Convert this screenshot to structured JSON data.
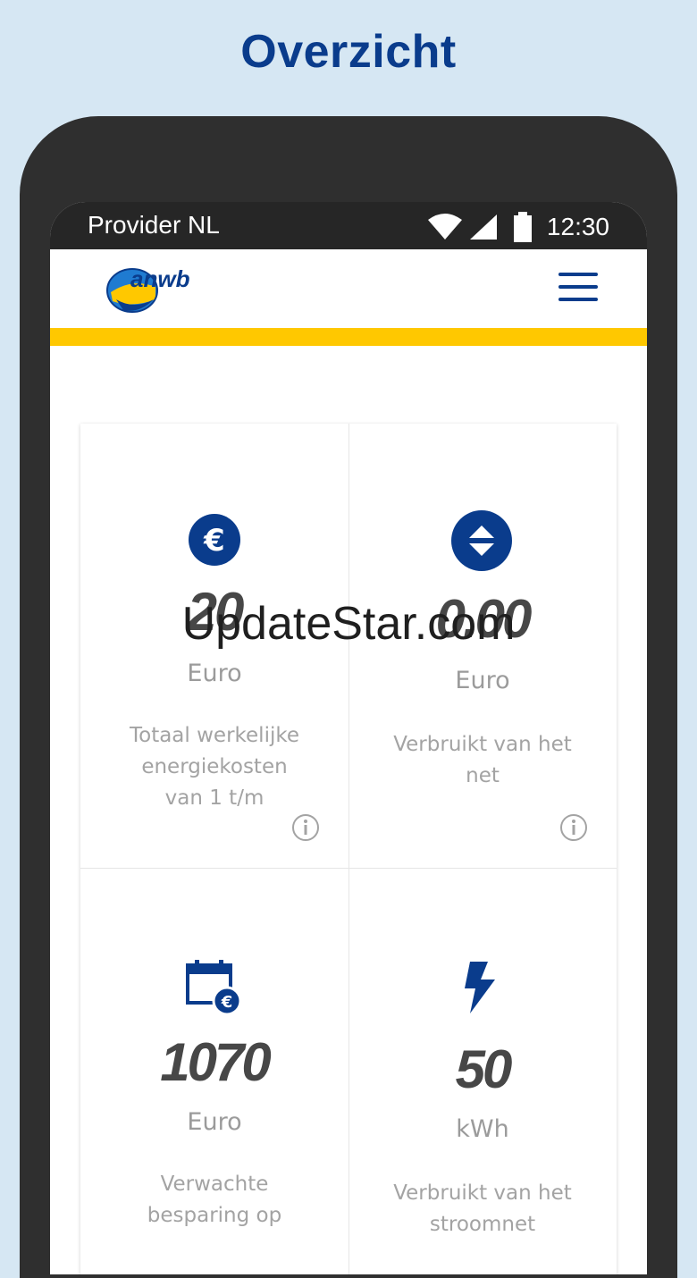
{
  "headline": "Overzicht",
  "statusbar": {
    "provider": "Provider NL",
    "time": "12:30"
  },
  "appbar": {
    "logo_text": "anwb",
    "menu_icon": "hamburger-menu-icon"
  },
  "colors": {
    "brand_blue": "#0a3c8c",
    "accent_yellow": "#ffc800"
  },
  "tiles": [
    {
      "icon": "euro-icon",
      "value": "20",
      "unit": "Euro",
      "description": "Totaal werkelijke energiekosten van 1 t/m",
      "info_icon": "info-icon"
    },
    {
      "icon": "up-down-arrows-icon",
      "value": "0.00",
      "unit": "Euro",
      "description": "Verbruikt van het net",
      "info_icon": "info-icon"
    },
    {
      "icon": "calendar-euro-icon",
      "value": "1070",
      "unit": "Euro",
      "description": "Verwachte besparing op"
    },
    {
      "icon": "lightning-icon",
      "value": "50",
      "unit": "kWh",
      "description": "Verbruikt van het stroomnet"
    }
  ],
  "watermark": "UpdateStar.com"
}
